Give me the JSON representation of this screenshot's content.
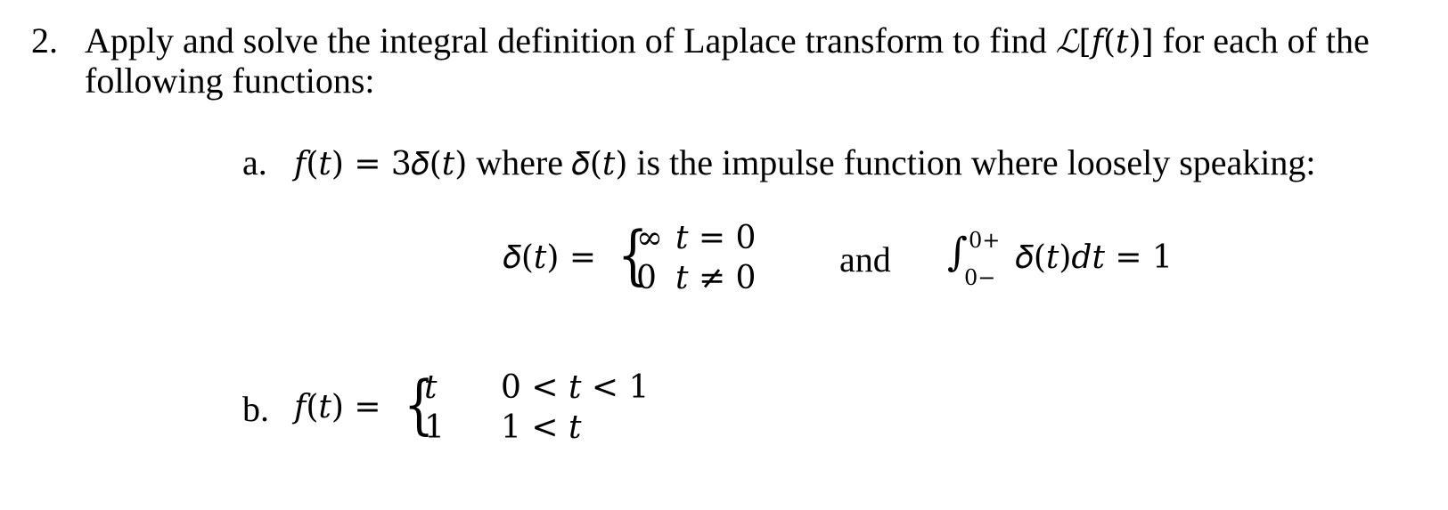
{
  "question": {
    "number": "2.",
    "line1": "Apply and solve the integral definition of Laplace transform to find",
    "laplace_symbol": "ℒ",
    "laplace_arg": "[𝑓(𝑡)]",
    "line1_tail": "for each of the",
    "line2": "following functions:"
  },
  "item_a": {
    "label": "a.",
    "lhs": "𝑓(𝑡) = 3𝛿(𝑡)",
    "text1": "where",
    "delta": "𝛿(𝑡)",
    "text2": "is the impulse function where loosely speaking:",
    "piecewise": {
      "lhs": "𝛿(𝑡) =",
      "rows": [
        {
          "value": "∞",
          "condition": "𝑡 = 0"
        },
        {
          "value": "0",
          "condition": "𝑡 ≠ 0"
        }
      ]
    },
    "connector": "and",
    "integral": {
      "upper": "0+",
      "lower": "0−",
      "integrand": "𝛿(𝑡)𝑑𝑡 = 1"
    }
  },
  "item_b": {
    "label": "b.",
    "lhs": "𝑓(𝑡) =",
    "rows": [
      {
        "value": "𝑡",
        "condition": "0 < 𝑡 < 1"
      },
      {
        "value": "1",
        "condition": "1 < 𝑡"
      }
    ]
  }
}
